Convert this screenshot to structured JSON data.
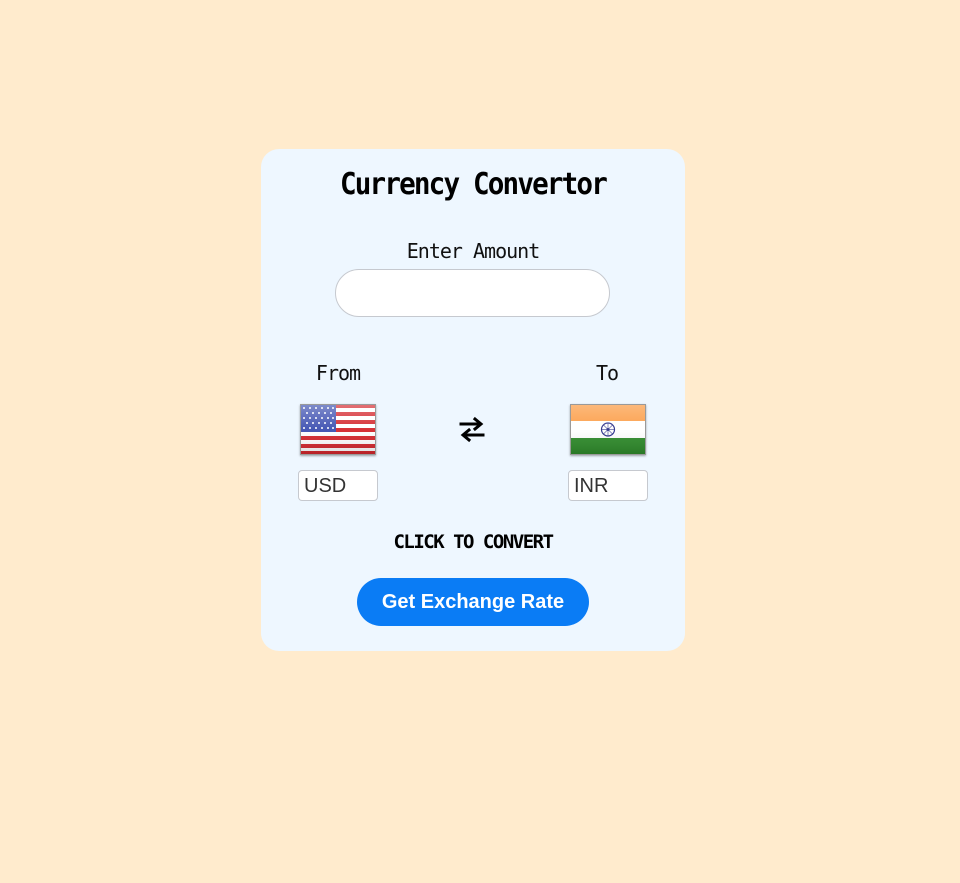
{
  "app": {
    "title": "Currency Convertor"
  },
  "amount": {
    "label": "Enter Amount",
    "value": "",
    "placeholder": ""
  },
  "from": {
    "label": "From",
    "currency": "USD",
    "flag_icon": "us-flag-icon"
  },
  "to": {
    "label": "To",
    "currency": "INR",
    "flag_icon": "india-flag-icon"
  },
  "swap": {
    "icon": "swap-arrows-icon"
  },
  "convert": {
    "hint": "CLICK TO CONVERT",
    "button_label": "Get Exchange Rate"
  },
  "colors": {
    "page_background": "#ffebcd",
    "card_background": "#eef7ff",
    "button": "#0a7cf5"
  }
}
